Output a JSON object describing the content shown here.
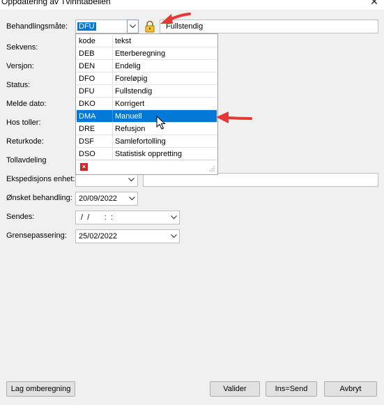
{
  "window": {
    "title": "Oppdatering av Tvinntabellen",
    "close_glyph": "✕"
  },
  "form": {
    "behandlingsmate": {
      "label": "Behandlingsmåte:",
      "value": "DFU",
      "lock_icon": "lock-icon",
      "description": "Fullstendig"
    },
    "sekvens": {
      "label": "Sekvens:"
    },
    "versjon": {
      "label": "Versjon:"
    },
    "status": {
      "label": "Status:"
    },
    "melde_dato": {
      "label": "Melde dato:"
    },
    "hos_toller": {
      "label": "Hos toller:"
    },
    "returkode": {
      "label": "Returkode:"
    },
    "tollavdeling": {
      "label": "Tollavdeling"
    },
    "ekspedisjons_enhet": {
      "label": "Ekspedisjons enhet:"
    },
    "onsket_behandling": {
      "label": "Ønsket behandling:",
      "value": "20/09/2022"
    },
    "sendes": {
      "label": "Sendes:",
      "value": " /  /       :  :"
    },
    "grensepassering": {
      "label": "Grensepassering:",
      "value": "25/02/2022"
    }
  },
  "dropdown": {
    "columns": [
      "kode",
      "tekst"
    ],
    "rows": [
      {
        "code": "DEB",
        "text": "Etterberegning"
      },
      {
        "code": "DEN",
        "text": "Endelig"
      },
      {
        "code": "DFO",
        "text": "Foreløpig"
      },
      {
        "code": "DFU",
        "text": "Fullstendig"
      },
      {
        "code": "DKO",
        "text": "Korrigert"
      },
      {
        "code": "DMA",
        "text": "Manuell"
      },
      {
        "code": "DRE",
        "text": "Refusjon"
      },
      {
        "code": "DSF",
        "text": "Samlefortolling"
      },
      {
        "code": "DSO",
        "text": "Statistisk oppretting"
      }
    ],
    "selected_code": "DMA",
    "footer_icon": "clear-icon"
  },
  "buttons": {
    "lag_omberegning": "Lag omberegning",
    "valider": "Valider",
    "ins_send": "Ins=Send",
    "avbryt": "Avbryt"
  },
  "colors": {
    "selection": "#0078d7",
    "annotation_arrow": "#e53935",
    "window_bg": "#f0f0f0"
  }
}
